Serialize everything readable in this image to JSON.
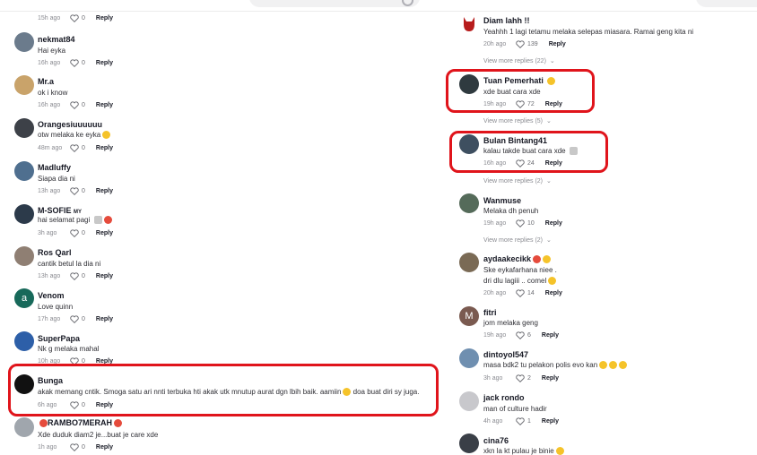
{
  "left": {
    "first_meta": {
      "time": "15h ago",
      "likes": "0",
      "reply": "Reply"
    },
    "comments": [
      {
        "user": "nekmat84",
        "text": "Hai eyka",
        "time": "16h ago",
        "likes": "0",
        "reply": "Reply",
        "avatar": "#6b7b8c"
      },
      {
        "user": "Mr.a",
        "text": "ok i know",
        "time": "16h ago",
        "likes": "0",
        "reply": "Reply",
        "avatar": "#c9a36a"
      },
      {
        "user": "Orangesiuuuuuu",
        "text": "otw melaka ke eyka",
        "time": "48m ago",
        "likes": "0",
        "reply": "Reply",
        "avatar": "#3d4148"
      },
      {
        "user": "Madluffy",
        "text": "Siapa dia ni",
        "time": "13h ago",
        "likes": "0",
        "reply": "Reply",
        "avatar": "#4f6f8f"
      },
      {
        "user": "M-SOFIE",
        "badge": "MY",
        "text": "hai selamat pagi",
        "time": "3h ago",
        "likes": "0",
        "reply": "Reply",
        "avatar": "#2c3a4a"
      },
      {
        "user": "Ros Qarl",
        "text": "cantik betul la dia ni",
        "time": "13h ago",
        "likes": "0",
        "reply": "Reply",
        "avatar": "#8f7f73"
      },
      {
        "user": "Venom",
        "text": "Love quinn",
        "time": "17h ago",
        "likes": "0",
        "reply": "Reply",
        "avatar": "#17695a",
        "initial": "a"
      },
      {
        "user": "SuperPapa",
        "text": "Nk g melaka mahal",
        "time": "10h ago",
        "likes": "0",
        "reply": "Reply",
        "avatar": "#2d5fa8"
      },
      {
        "user": "Bunga",
        "text": "akak memang cntik. Smoga satu ari nnti terbuka hti akak utk mnutup aurat dgn lbih baik. aamiin",
        "text2": "doa buat diri sy juga.",
        "time": "6h ago",
        "likes": "0",
        "reply": "Reply",
        "avatar": "#111111"
      },
      {
        "user": "RAMBO7MERAH",
        "text": "Xde duduk diam2 je...buat je care xde",
        "time": "1h ago",
        "likes": "0",
        "reply": "Reply",
        "avatar": "#a0a6ad"
      }
    ]
  },
  "right": {
    "comments": [
      {
        "user": "Diam lahh !!",
        "text": "Yeahhh 1 lagi tetamu melaka selepas miasara. Ramai geng kita ni",
        "time": "20h ago",
        "likes": "139",
        "reply": "Reply",
        "more": "View more replies (22)",
        "avatar": "#b71c1c"
      },
      {
        "user": "Tuan Pemerhati",
        "text": "xde buat cara xde",
        "time": "19h ago",
        "likes": "72",
        "reply": "Reply",
        "more": "View more replies (5)",
        "avatar": "#2f3a3f"
      },
      {
        "user": "Bulan Bintang41",
        "text": "kalau takde buat cara xde",
        "time": "16h ago",
        "likes": "24",
        "reply": "Reply",
        "more": "View more replies (2)",
        "avatar": "#3e4f60"
      },
      {
        "user": "Wanmuse",
        "text": "Melaka dh penuh",
        "time": "19h ago",
        "likes": "10",
        "reply": "Reply",
        "more": "View more replies (2)",
        "avatar": "#556b5a"
      },
      {
        "user": "aydaakecikk",
        "text": "Ske eykafarhana niee .",
        "text2": "dri dlu lagiii .. comel",
        "time": "20h ago",
        "likes": "14",
        "reply": "Reply",
        "avatar": "#7a6a55"
      },
      {
        "user": "fitri",
        "text": "jom melaka geng",
        "time": "19h ago",
        "likes": "6",
        "reply": "Reply",
        "avatar": "#7a5a50",
        "initial": "M"
      },
      {
        "user": "dintoyol547",
        "text": "masa bdk2 tu pelakon polis evo kan",
        "time": "3h ago",
        "likes": "2",
        "reply": "Reply",
        "avatar": "#6f8fb0"
      },
      {
        "user": "jack rondo",
        "text": "man of culture hadir",
        "time": "4h ago",
        "likes": "1",
        "reply": "Reply",
        "avatar": "#c8c8cc"
      },
      {
        "user": "cina76",
        "text": "xkn la kt pulau je binie",
        "time": "",
        "likes": "",
        "reply": "",
        "avatar": "#3a3f47"
      }
    ]
  },
  "colors": {
    "highlight": "#e0141b",
    "text": "#161823",
    "muted": "#8a8b91"
  }
}
